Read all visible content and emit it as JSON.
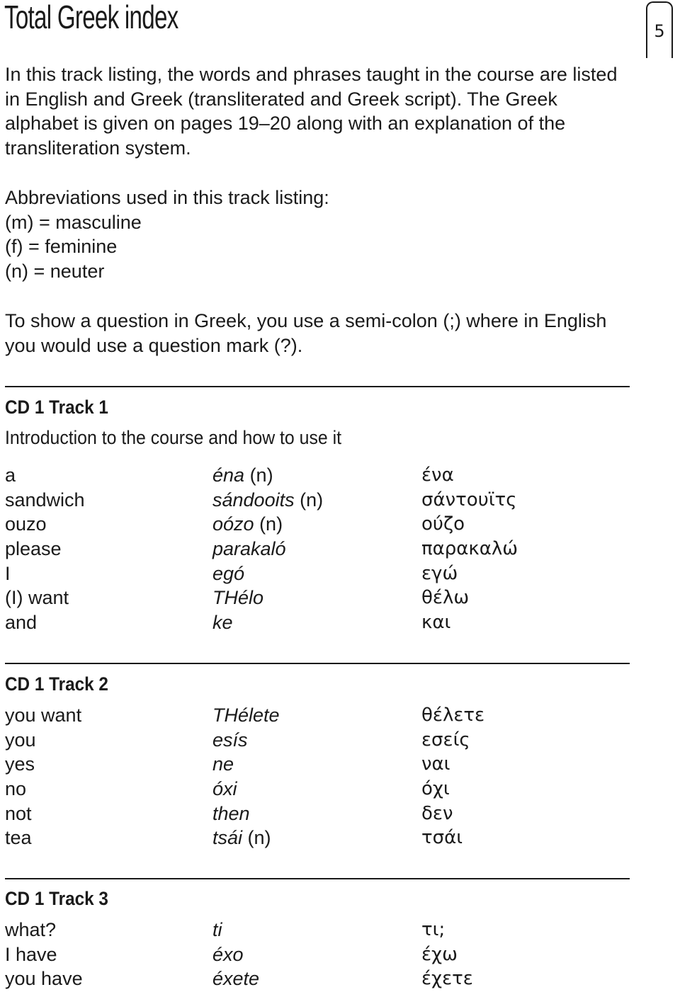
{
  "page": {
    "title": "Total Greek index",
    "page_number": "5"
  },
  "intro": {
    "paragraph1": "In this track listing, the words and phrases taught in the course are listed in English and Greek (transliterated and Greek script). The Greek alphabet is given on pages 19–20 along with an explanation of the transliteration system.",
    "abbrev_heading": "Abbreviations used in this track listing:",
    "abbreviations": [
      "(m) = masculine",
      "(f) = feminine",
      "(n) = neuter"
    ],
    "paragraph3": "To show a question in Greek, you use a semi-colon (;) where in English you would use a question mark (?)."
  },
  "tracks": [
    {
      "heading": "CD 1 Track 1",
      "subtitle": "Introduction to the course and how to use it",
      "entries": [
        {
          "en": "a",
          "tr": "éna",
          "gender": " (n)",
          "gr": "ένα"
        },
        {
          "en": "sandwich",
          "tr": "sándooits",
          "gender": " (n)",
          "gr": "σάντουϊτς"
        },
        {
          "en": "ouzo",
          "tr": "oózo",
          "gender": " (n)",
          "gr": "ούζο"
        },
        {
          "en": "please",
          "tr": "parakaló",
          "gender": "",
          "gr": "παρακαλώ"
        },
        {
          "en": "I",
          "tr": "egó",
          "gender": "",
          "gr": "εγώ"
        },
        {
          "en": "(I) want",
          "tr": "THélo",
          "gender": "",
          "gr": "θέλω"
        },
        {
          "en": "and",
          "tr": "ke",
          "gender": "",
          "gr": "και"
        }
      ]
    },
    {
      "heading": "CD 1 Track 2",
      "entries": [
        {
          "en": "you want",
          "tr": "THélete",
          "gender": "",
          "gr": "θέλετε"
        },
        {
          "en": "you",
          "tr": "esís",
          "gender": "",
          "gr": "εσείς"
        },
        {
          "en": "yes",
          "tr": "ne",
          "gender": "",
          "gr": "ναι"
        },
        {
          "en": "no",
          "tr": "óxi",
          "gender": "",
          "gr": "όχι"
        },
        {
          "en": "not",
          "tr": "then",
          "gender": "",
          "gr": "δεν"
        },
        {
          "en": "tea",
          "tr": "tsái",
          "gender": " (n)",
          "gr": "τσάι"
        }
      ]
    },
    {
      "heading": "CD 1 Track 3",
      "entries": [
        {
          "en": "what?",
          "tr": "ti",
          "gender": "",
          "gr": "τι;"
        },
        {
          "en": "I have",
          "tr": "éxo",
          "gender": "",
          "gr": "έχω"
        },
        {
          "en": "you have",
          "tr": "éxete",
          "gender": "",
          "gr": "έχετε"
        }
      ]
    }
  ]
}
